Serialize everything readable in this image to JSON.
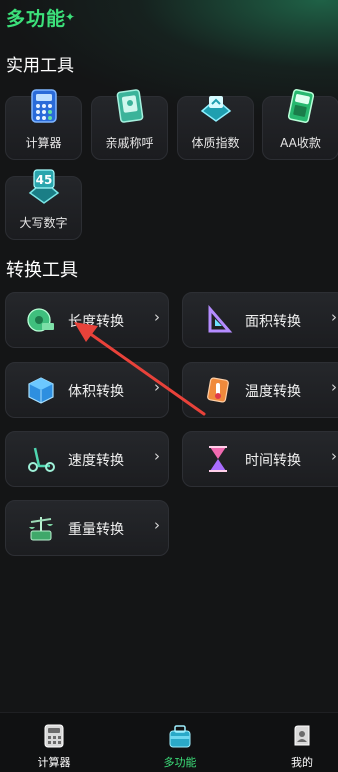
{
  "header": {
    "title": "多功能"
  },
  "practical": {
    "title": "实用工具",
    "items": [
      {
        "label": "计算器",
        "icon": "calculator-icon"
      },
      {
        "label": "亲戚称呼",
        "icon": "relatives-book-icon"
      },
      {
        "label": "体质指数",
        "icon": "bmi-scale-icon"
      },
      {
        "label": "AA收款",
        "icon": "pos-terminal-icon"
      },
      {
        "label": "大写数字",
        "icon": "number-45-icon"
      }
    ]
  },
  "conversion": {
    "title": "转换工具",
    "items": [
      {
        "label": "长度转换",
        "icon": "tape-measure-icon"
      },
      {
        "label": "面积转换",
        "icon": "ruler-triangle-icon"
      },
      {
        "label": "体积转换",
        "icon": "cube-icon"
      },
      {
        "label": "温度转换",
        "icon": "thermometer-icon"
      },
      {
        "label": "速度转换",
        "icon": "scooter-icon"
      },
      {
        "label": "时间转换",
        "icon": "hourglass-icon"
      },
      {
        "label": "重量转换",
        "icon": "scale-icon"
      }
    ],
    "chevron": "›"
  },
  "tabbar": {
    "items": [
      {
        "label": "计算器",
        "icon": "calculator-tab-icon"
      },
      {
        "label": "多功能",
        "icon": "toolbox-tab-icon",
        "active": true
      },
      {
        "label": "我的",
        "icon": "profile-tab-icon"
      }
    ]
  },
  "colors": {
    "accent": "#3ce07a",
    "background": "#141516",
    "card": "#232529"
  }
}
